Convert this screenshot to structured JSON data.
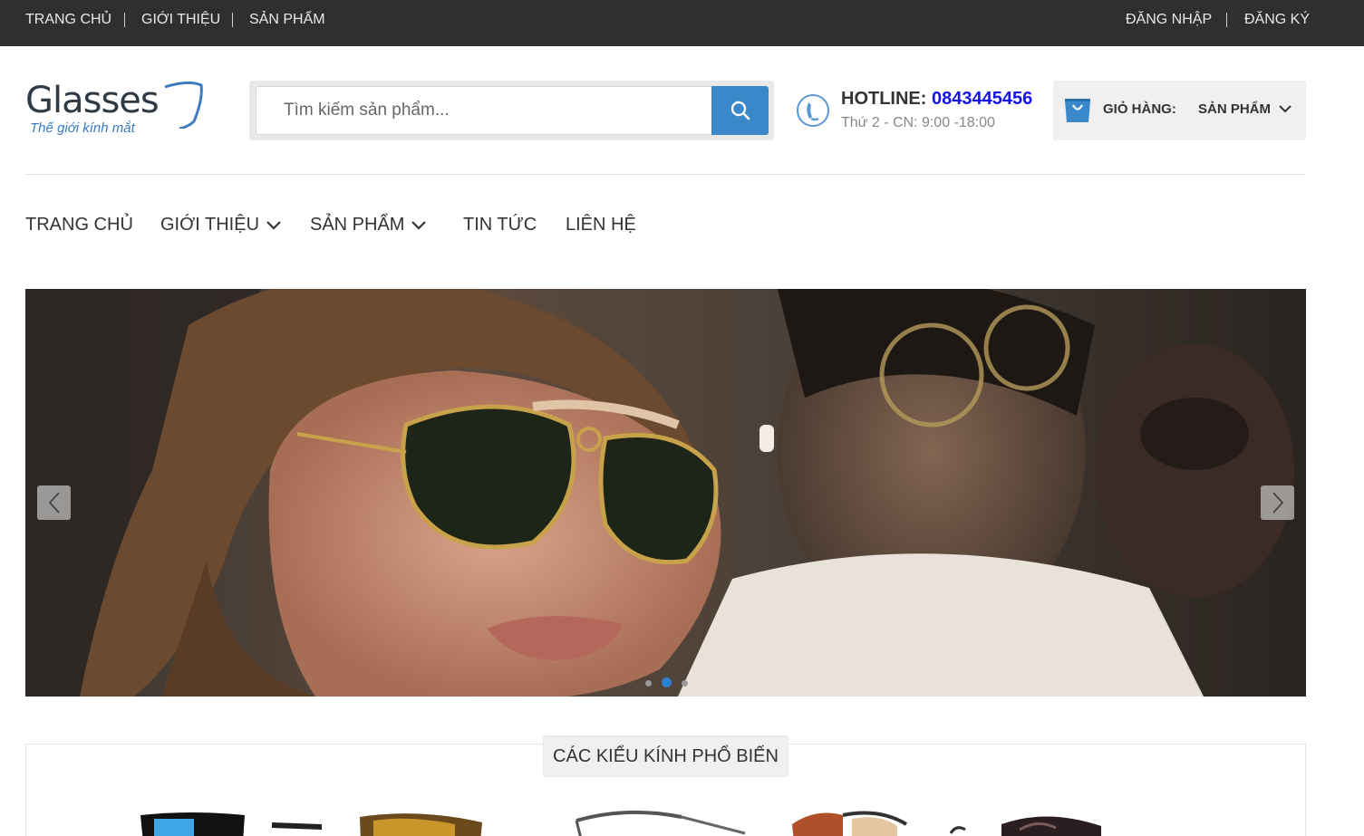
{
  "topbar": {
    "left_links": [
      "TRANG CHỦ",
      "GIỚI THIỆU",
      "SẢN PHẨM"
    ],
    "right_links": [
      "ĐĂNG NHẬP",
      "ĐĂNG KÝ"
    ]
  },
  "logo": {
    "main": "Glasses",
    "tagline": "Thế giới kính mắt"
  },
  "search": {
    "placeholder": "Tìm kiếm sản phẩm..."
  },
  "hotline": {
    "label": "HOTLINE: ",
    "number": "0843445456",
    "hours": "Thứ 2 - CN: 9:00 -18:00"
  },
  "cart": {
    "label": "GIỎ HÀNG:",
    "count_text": "SẢN PHẨM"
  },
  "nav": [
    {
      "label": "TRANG CHỦ",
      "has_dropdown": false
    },
    {
      "label": "GIỚI THIỆU",
      "has_dropdown": true
    },
    {
      "label": "SẢN PHẨM",
      "has_dropdown": true
    },
    {
      "label": "TIN TỨC",
      "has_dropdown": false
    },
    {
      "label": "LIÊN HỆ",
      "has_dropdown": false
    }
  ],
  "banner": {
    "slide_count": 3,
    "active_slide": 2
  },
  "popular": {
    "title": "CÁC KIỂU KÍNH PHỔ BIẾN"
  },
  "colors": {
    "topbar_bg": "#2f2f2f",
    "accent": "#3a87c9",
    "hotline_number": "#1414e6"
  },
  "icons": [
    "search-icon",
    "phone-icon",
    "shopping-bag-icon",
    "chevron-down-icon",
    "arrow-left-icon",
    "arrow-right-icon"
  ]
}
